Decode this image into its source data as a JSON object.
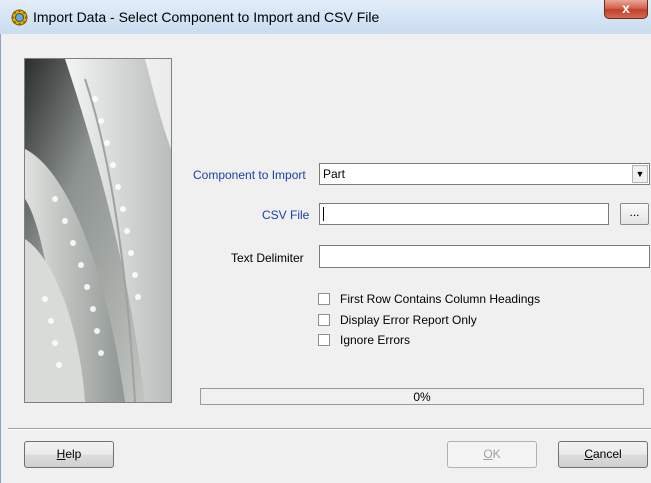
{
  "window": {
    "title": "Import Data - Select Component to Import and CSV File",
    "close_label": "x"
  },
  "form": {
    "component_label": "Component to Import",
    "component_value": "Part",
    "csv_label": "CSV File",
    "csv_value": "",
    "browse_label": "...",
    "delimiter_label": "Text Delimiter",
    "delimiter_value": ""
  },
  "checkboxes": [
    {
      "label": "First Row Contains Column Headings",
      "checked": false
    },
    {
      "label": "Display Error Report Only",
      "checked": false
    },
    {
      "label": "Ignore Errors",
      "checked": false
    }
  ],
  "progress": {
    "text": "0%",
    "value": 0
  },
  "buttons": {
    "help": {
      "mnemonic": "H",
      "rest": "elp"
    },
    "ok": {
      "mnemonic": "O",
      "rest": "K",
      "enabled": false
    },
    "cancel": {
      "mnemonic": "C",
      "rest": "ancel"
    }
  },
  "colors": {
    "label_accent": "#1a3fa8",
    "title_bar": "#d5e4f5"
  }
}
